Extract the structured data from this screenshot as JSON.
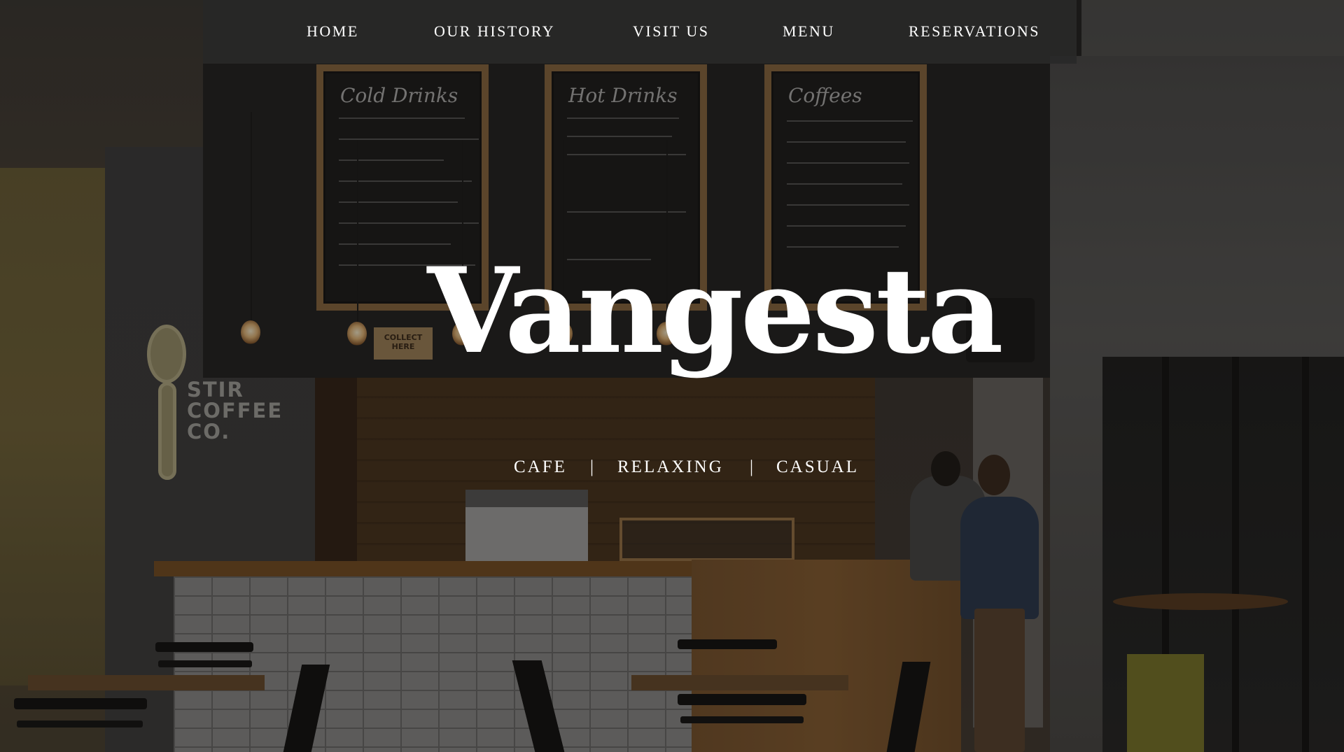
{
  "nav": {
    "items": [
      {
        "label": "HOME"
      },
      {
        "label": "OUR HISTORY"
      },
      {
        "label": "VISIT US"
      },
      {
        "label": "MENU"
      },
      {
        "label": "RESERVATIONS"
      }
    ]
  },
  "hero": {
    "brand": "Vangesta",
    "tags": [
      "CAFE",
      "RELAXING",
      "CASUAL"
    ],
    "separator": "|"
  },
  "scene": {
    "boards": [
      {
        "title": "Cold Drinks"
      },
      {
        "title": "Hot Drinks"
      },
      {
        "title": "Coffees"
      }
    ],
    "wall_logo": "STIR COFFEE CO.",
    "collect_sign": "COLLECT HERE"
  },
  "colors": {
    "nav_bg": "#282828",
    "text": "#ffffff",
    "wood": "#8d6b43"
  }
}
